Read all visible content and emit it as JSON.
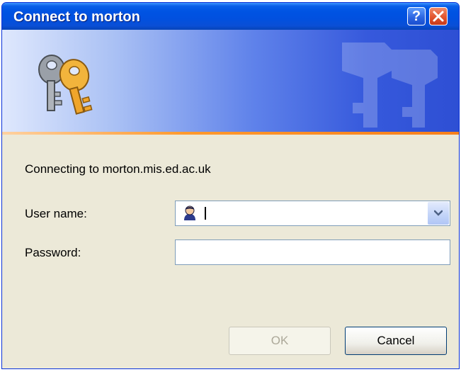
{
  "window": {
    "title": "Connect to morton",
    "help_button": "?",
    "close_button_icon": "close-icon"
  },
  "banner": {
    "icon": "keys-icon",
    "watermark_icon": "keys-watermark-icon"
  },
  "dialog": {
    "message": "Connecting to morton.mis.ed.ac.uk",
    "username": {
      "label": "User name:",
      "value": "",
      "icon": "user-icon"
    },
    "password": {
      "label": "Password:",
      "value": ""
    },
    "ok_label": "OK",
    "cancel_label": "Cancel",
    "ok_enabled": false
  },
  "colors": {
    "titlebar": "#0054e3",
    "window_bg": "#ece9d8",
    "accent_line": "#f7801b",
    "close_button": "#e2552f"
  }
}
